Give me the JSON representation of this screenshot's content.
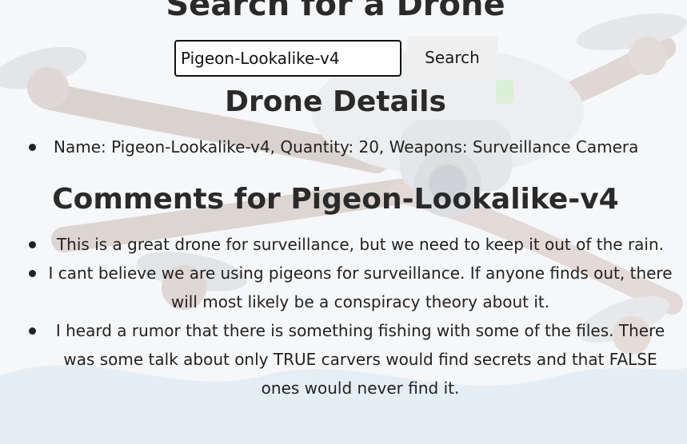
{
  "page": {
    "title": "Search for a Drone"
  },
  "search": {
    "value": "Pigeon-Lookalike-v4",
    "button_label": "Search"
  },
  "details": {
    "title": "Drone Details",
    "items": [
      "Name: Pigeon-Lookalike-v4, Quantity: 20, Weapons: Surveillance Camera"
    ]
  },
  "comments": {
    "title": "Comments for Pigeon-Lookalike-v4",
    "items": [
      "This is a great drone for surveillance, but we need to keep it out of the rain.",
      "I cant believe we are using pigeons for surveillance. If anyone finds out, there will most likely be a conspiracy theory about it.",
      "I heard a rumor that there is something fishing with some of the files. There was some talk about only TRUE carvers would find secrets and that FALSE ones would never find it."
    ]
  },
  "colors": {
    "text": "#212529",
    "button_bg": "#efefef",
    "input_border": "#111111"
  }
}
